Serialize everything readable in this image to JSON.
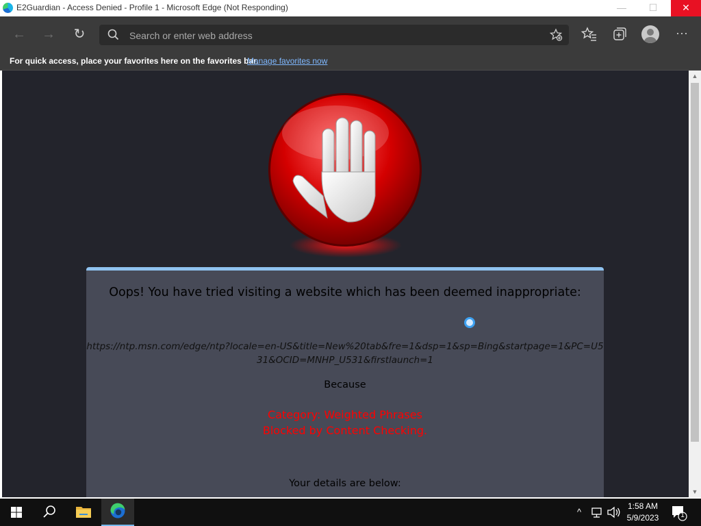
{
  "window": {
    "title": "E2Guardian - Access Denied - Profile 1 - Microsoft Edge (Not Responding)",
    "minimize": "—",
    "maximize": "☐",
    "close": "✕"
  },
  "toolbar": {
    "back_icon": "←",
    "forward_icon": "→",
    "reload_icon": "↻",
    "address_placeholder": "Search or enter web address",
    "more_icon": "···"
  },
  "favorites_bar": {
    "message": "For quick access, place your favorites here on the favorites bar.",
    "link": "Manage favorites now"
  },
  "page": {
    "heading": "Oops! You have tried visiting a website which has been deemed inappropriate:",
    "blocked_url": "https://ntp.msn.com/edge/ntp?locale=en-US&title=New%20tab&fre=1&dsp=1&sp=Bing&startpage=1&PC=U531&OCID=MNHP_U531&firstlaunch=1",
    "because": "Because",
    "category": "Category: Weighted Phrases",
    "reason": "Blocked by Content Checking.",
    "details": "Your details are below:"
  },
  "taskbar": {
    "chevron": "^",
    "time": "1:58 AM",
    "date": "5/9/2023",
    "notification_count": "1"
  },
  "colors": {
    "page_background": "#23242c",
    "panel_background": "#474a57",
    "panel_border": "#8fc2ef",
    "category_text": "#ff0000",
    "close_button": "#e81123"
  }
}
